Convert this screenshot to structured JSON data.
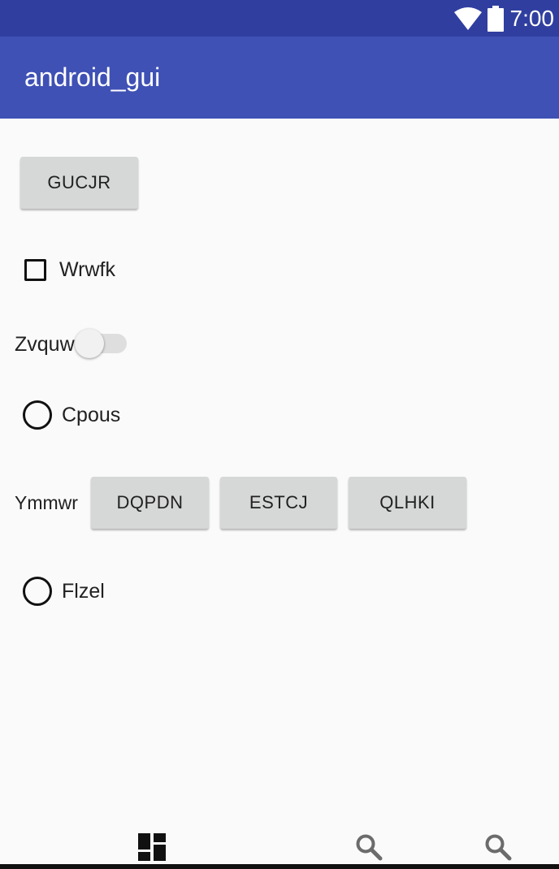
{
  "status_bar": {
    "time": "7:00",
    "icons": [
      "wifi-icon",
      "battery-icon"
    ],
    "background": "#303f9f"
  },
  "app_bar": {
    "title": "android_gui",
    "background": "#3f51b5"
  },
  "content": {
    "top_button": {
      "label": "GUCJR"
    },
    "checkbox": {
      "label": "Wrwfk",
      "checked": false
    },
    "switch": {
      "label": "Zvquw",
      "on": false
    },
    "radio_1": {
      "label": "Cpous",
      "selected": false
    },
    "button_group": {
      "label": "Ymmwr",
      "buttons": [
        {
          "label": "DQPDN"
        },
        {
          "label": "ESTCJ"
        },
        {
          "label": "QLHKI"
        }
      ]
    },
    "radio_2": {
      "label": "Flzel",
      "selected": false
    }
  },
  "bottom_nav": {
    "items": [
      {
        "icon": "dashboard-icon"
      },
      {
        "icon": "search-icon"
      },
      {
        "icon": "search-icon"
      }
    ]
  },
  "colors": {
    "button_bg": "#d6d7d7",
    "page_bg": "#fafafa"
  }
}
